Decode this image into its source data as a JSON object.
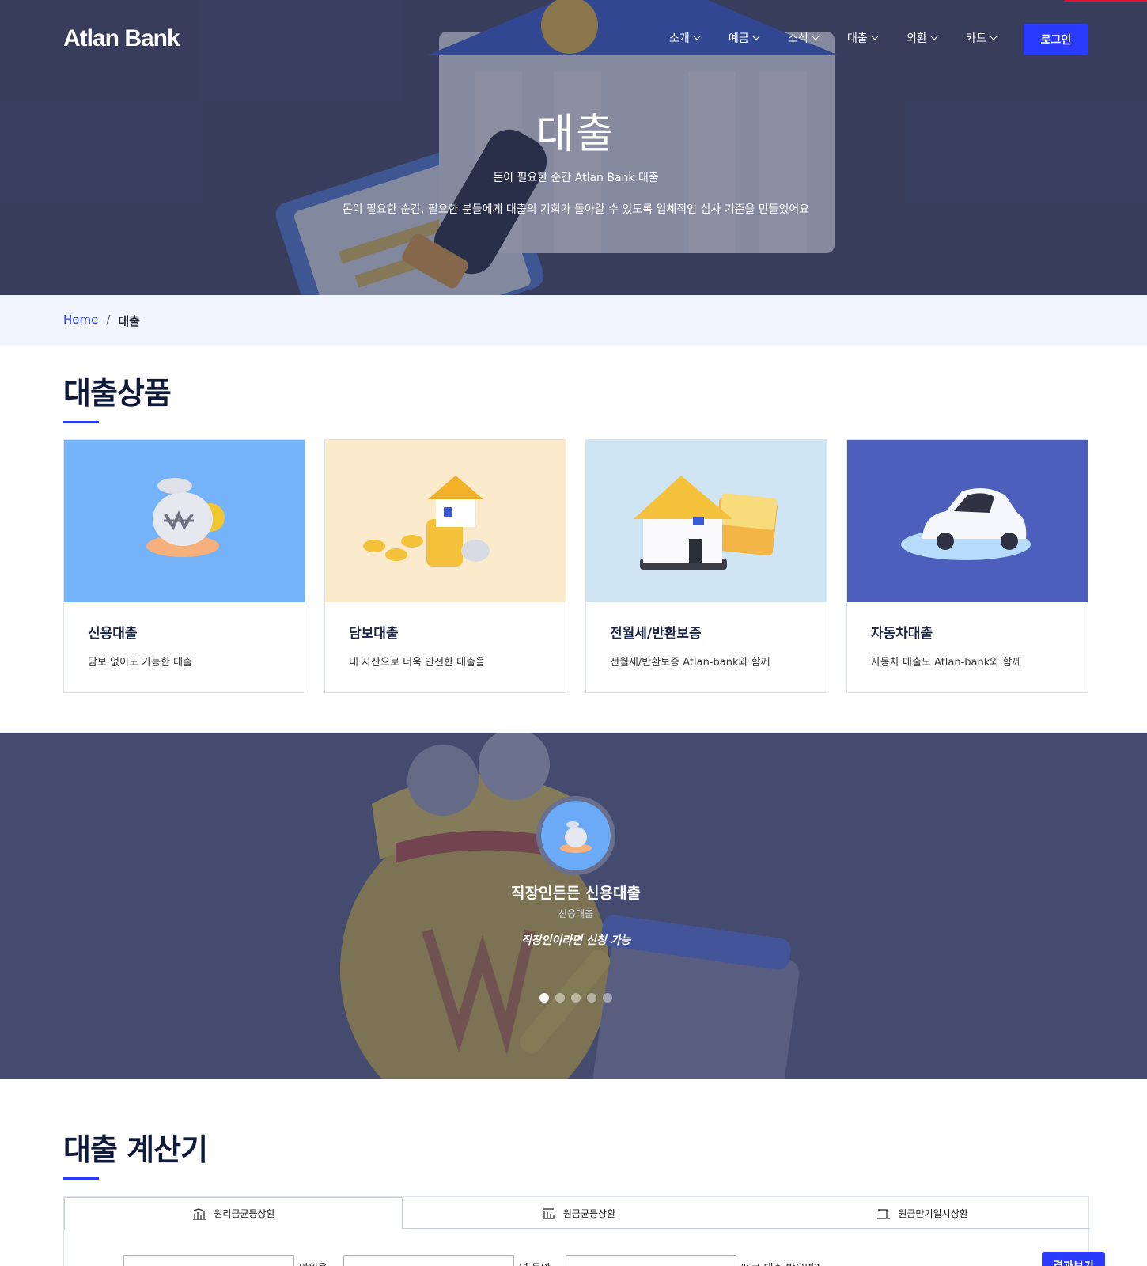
{
  "header": {
    "logo": "Atlan Bank",
    "nav": [
      {
        "label": "소개"
      },
      {
        "label": "예금"
      },
      {
        "label": "소식"
      },
      {
        "label": "대출"
      },
      {
        "label": "외환"
      },
      {
        "label": "카드"
      }
    ],
    "login_label": "로그인"
  },
  "hero": {
    "title": "대출",
    "subtitle": "돈이 필요한 순간 Atlan Bank 대출",
    "description": "돈이 필요한 순간, 필요한 분들에게 대출의 기회가 돌아갈 수 있도록 입체적인 심사 기준을 만들었어요"
  },
  "breadcrumb": {
    "home": "Home",
    "separator": "/",
    "current": "대출"
  },
  "products": {
    "title": "대출상품",
    "cards": [
      {
        "title": "신용대출",
        "desc": "담보 없이도 가능한 대출",
        "bg": "#74b2fa",
        "icon": "money-bag-hand-icon"
      },
      {
        "title": "담보대출",
        "desc": "내 자산으로 더욱 안전한 대출을",
        "bg": "#fbebcc",
        "icon": "house-coins-icon"
      },
      {
        "title": "전월세/반환보증",
        "desc": "전월세/반환보증 Atlan-bank와 함께",
        "bg": "#cfe5f3",
        "icon": "house-cash-icon"
      },
      {
        "title": "자동차대출",
        "desc": "자동차 대출도 Atlan-bank와 함께",
        "bg": "#4c5fbd",
        "icon": "car-icon"
      }
    ]
  },
  "carousel": {
    "title": "직장인든든 신용대출",
    "category": "신용대출",
    "quote": "직장인이라면 신청 가능",
    "dot_count": 5,
    "active_dot": 0
  },
  "calculator": {
    "title": "대출 계산기",
    "tabs": [
      {
        "label": "원리금균등상환",
        "icon": "chart-bars-icon"
      },
      {
        "label": "원금균등상환",
        "icon": "chart-bars-icon"
      },
      {
        "label": "원금만기일시상환",
        "icon": "chart-step-icon"
      }
    ],
    "text1": "만원을",
    "text2": "년 동안",
    "text3": "%로 대출 받으면?",
    "submit_label": "결과보기"
  },
  "colors": {
    "accent": "#2a3bff",
    "navy": "#0f1a3a"
  }
}
